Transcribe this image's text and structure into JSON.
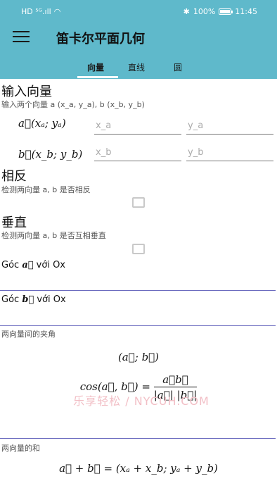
{
  "status_bar": {
    "signal": "HD ⁵ᴳ.ıll",
    "battery": "100%",
    "time": "11:45",
    "battery_level": 1.0
  },
  "app": {
    "title": "笛卡尔平面几何"
  },
  "tabs": [
    {
      "label": "向量",
      "active": true
    },
    {
      "label": "直线",
      "active": false
    },
    {
      "label": "圆",
      "active": false
    }
  ],
  "input_section": {
    "title": "输入向量",
    "hint": "输入两个向量 a (x_a, y_a), b (x_b, y_b)",
    "vector_a": "a⃗(xₐ; yₐ)",
    "vector_b": "b⃗(x_b; y_b)",
    "placeholders": {
      "x_a": "x_a",
      "y_a": "y_a",
      "x_b": "x_b",
      "y_b": "y_b"
    }
  },
  "opposite_section": {
    "title": "相反",
    "hint": "检测两向量 a, b 是否相反",
    "checked": false
  },
  "perpendicular_section": {
    "title": "垂直",
    "hint": "检测两向量 a, b 是否互相垂直",
    "checked": false
  },
  "angle_a": {
    "prefix": "Góc ",
    "vector": "a⃗",
    "suffix": " với Ox"
  },
  "angle_b": {
    "prefix": "Góc ",
    "vector": "b⃗",
    "suffix": " với Ox"
  },
  "angle_between": {
    "hint": "两向量间的夹角",
    "notation": "(a⃗; b⃗)",
    "formula_lhs": "cos(a⃗, b⃗) =",
    "numerator": "a⃗b⃗",
    "denominator": "|a⃗| |b⃗|"
  },
  "sum": {
    "hint": "两向量的和",
    "formula": "a⃗ + b⃗ = (xₐ + x_b; yₐ + y_b)"
  },
  "watermark": "乐享轻松 / NYCUH.COM",
  "colors": {
    "primary": "#5fb9cb",
    "divider": "#6b6bbf",
    "watermark": "#f2bfc6"
  }
}
